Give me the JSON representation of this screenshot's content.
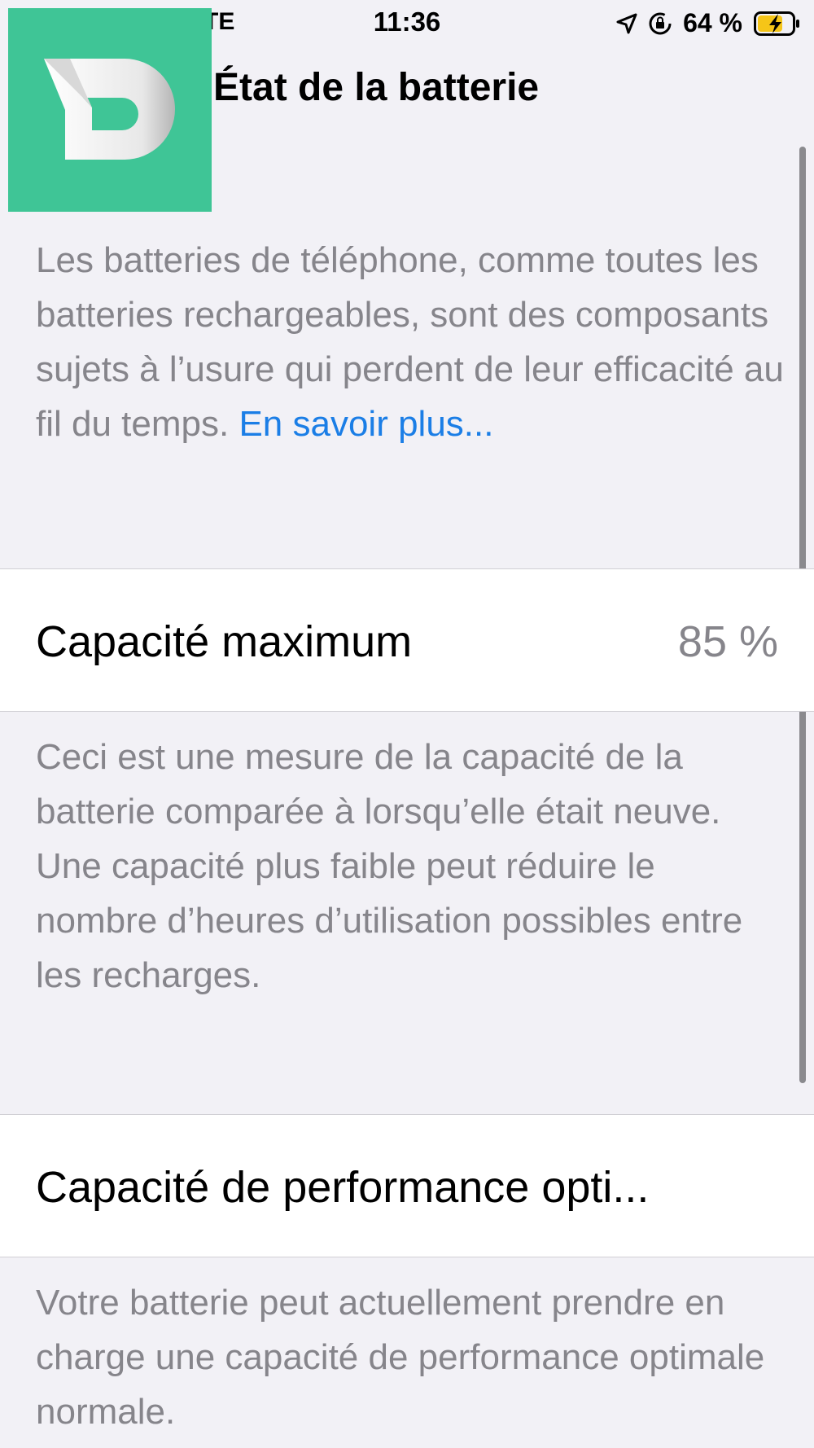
{
  "status_bar": {
    "carrier": "TE",
    "time": "11:36",
    "battery_percent": "64 %",
    "icons": [
      "location-arrow-icon",
      "rotation-lock-icon",
      "battery-charging-icon"
    ],
    "battery_color": "#f5c518"
  },
  "nav": {
    "title": "État de la batterie"
  },
  "logo": {
    "letter": "D",
    "background": "#3fc596"
  },
  "intro": {
    "text": "Les batteries de téléphone, comme toutes les batteries rechargeables, sont des composants sujets à l’usure qui perdent de leur efficacité au fil du temps. ",
    "link": "En savoir plus..."
  },
  "max_capacity": {
    "label": "Capacité maximum",
    "value": "85 %",
    "description": "Ceci est une mesure de la capacité de la batterie comparée à lorsqu’elle était neuve. Une capacité plus faible peut réduire le nombre d’heures d’utilisation possibles entre les recharges."
  },
  "performance": {
    "label": "Capacité de performance opti...",
    "description": "Votre batterie peut actuellement prendre en charge une capacité de performance optimale normale."
  },
  "colors": {
    "background": "#f2f1f6",
    "link": "#1b7ee6",
    "secondary_text": "#86858b"
  }
}
